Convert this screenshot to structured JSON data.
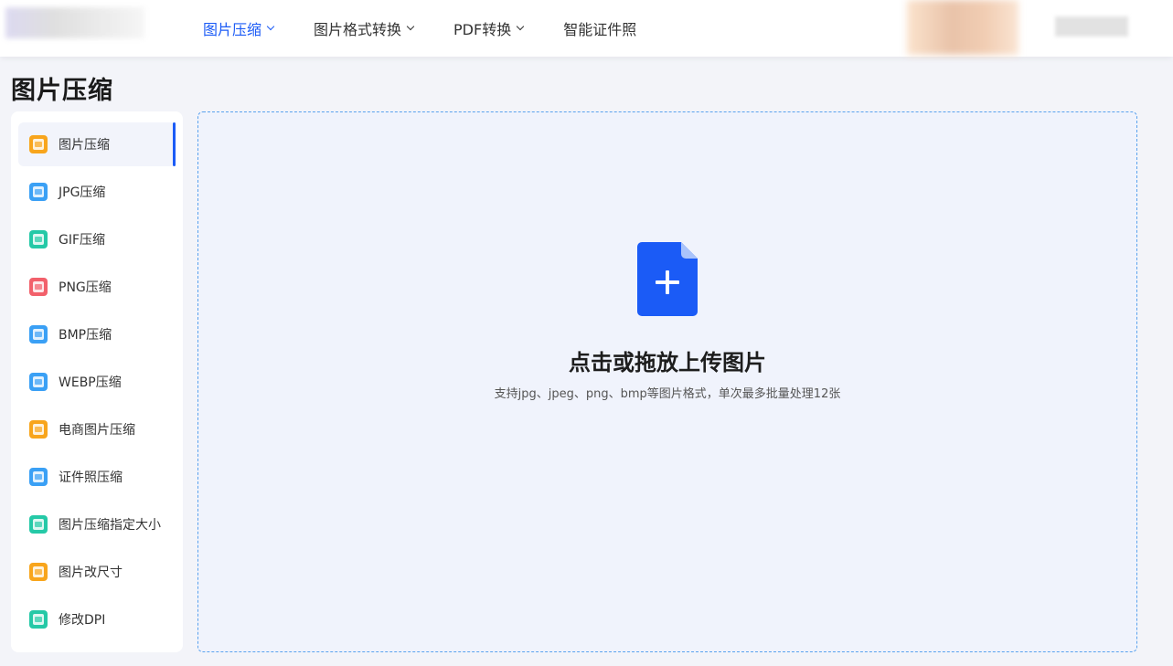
{
  "nav": {
    "items": [
      {
        "label": "图片压缩",
        "active": true,
        "dropdown": true
      },
      {
        "label": "图片格式转换",
        "active": false,
        "dropdown": true
      },
      {
        "label": "PDF转换",
        "active": false,
        "dropdown": true
      },
      {
        "label": "智能证件照",
        "active": false,
        "dropdown": false
      }
    ],
    "accent_color": "#1b5bf6"
  },
  "page": {
    "title": "图片压缩"
  },
  "sidebar": {
    "items": [
      {
        "label": "图片压缩",
        "icon": "image-compress-icon",
        "color": "#f8a51c",
        "active": true
      },
      {
        "label": "JPG压缩",
        "icon": "jpg-icon",
        "color": "#3aa0f5",
        "active": false
      },
      {
        "label": "GIF压缩",
        "icon": "gif-icon",
        "color": "#25c9a7",
        "active": false
      },
      {
        "label": "PNG压缩",
        "icon": "png-icon",
        "color": "#f2606b",
        "active": false
      },
      {
        "label": "BMP压缩",
        "icon": "bmp-icon",
        "color": "#3aa0f5",
        "active": false
      },
      {
        "label": "WEBP压缩",
        "icon": "webp-icon",
        "color": "#3aa0f5",
        "active": false
      },
      {
        "label": "电商图片压缩",
        "icon": "shopping-bag-icon",
        "color": "#f8a51c",
        "active": false
      },
      {
        "label": "证件照压缩",
        "icon": "id-photo-icon",
        "color": "#3aa0f5",
        "active": false
      },
      {
        "label": "图片压缩指定大小",
        "icon": "kb-size-icon",
        "color": "#25c9a7",
        "active": false
      },
      {
        "label": "图片改尺寸",
        "icon": "crop-icon",
        "color": "#f8a51c",
        "active": false
      },
      {
        "label": "修改DPI",
        "icon": "monitor-icon",
        "color": "#25c9a7",
        "active": false
      }
    ]
  },
  "upload": {
    "title": "点击或拖放上传图片",
    "subtitle": "支持jpg、jpeg、png、bmp等图片格式，单次最多批量处理12张",
    "icon": "file-add-icon",
    "icon_color": "#1b5bf6"
  }
}
